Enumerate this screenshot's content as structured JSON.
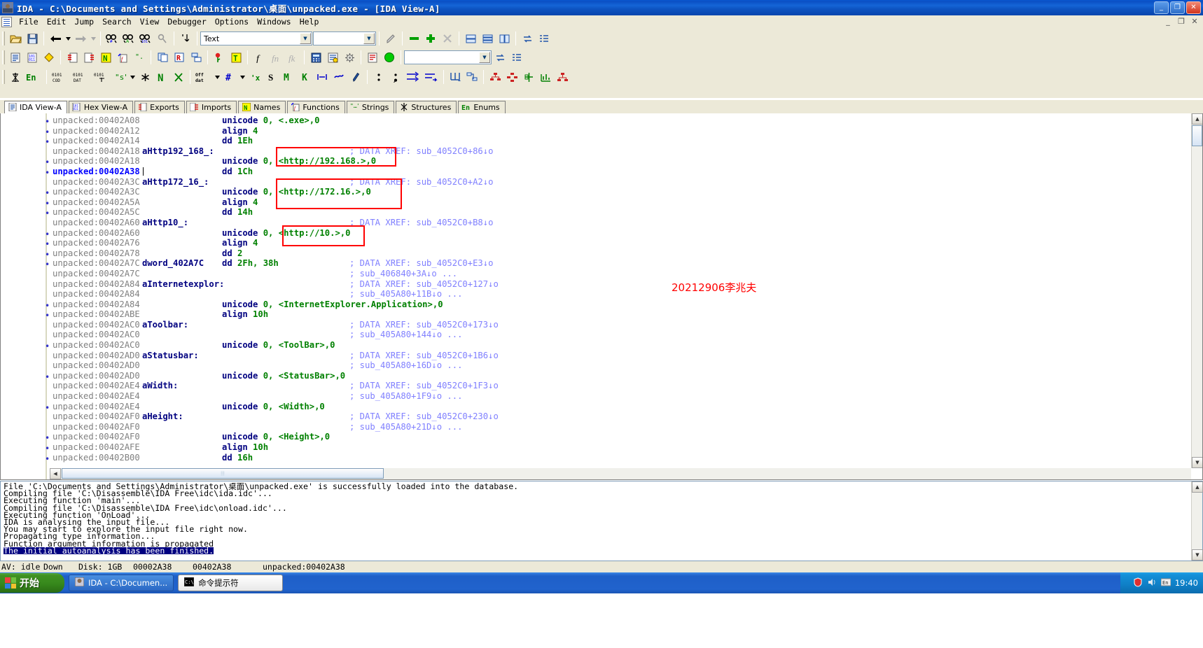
{
  "window": {
    "title": "IDA - C:\\Documents and Settings\\Administrator\\桌面\\unpacked.exe - [IDA View-A]",
    "minimize_label": "_",
    "maximize_label": "❐",
    "close_label": "✕",
    "mdi_minimize": "_",
    "mdi_restore": "❐",
    "mdi_close": "✕"
  },
  "menu": {
    "items": [
      {
        "label": "File"
      },
      {
        "label": "Edit"
      },
      {
        "label": "Jump"
      },
      {
        "label": "Search"
      },
      {
        "label": "View"
      },
      {
        "label": "Debugger"
      },
      {
        "label": "Options"
      },
      {
        "label": "Windows"
      },
      {
        "label": "Help"
      }
    ]
  },
  "toolbar": {
    "search_type_value": "Text",
    "search_term_value": "",
    "jump_combo_value": "",
    "func_combo_value": "",
    "accent_red": "#ff0000",
    "accent_green": "#008000",
    "accent_blue": "#0000ff"
  },
  "tabs": [
    {
      "label": "IDA View-A",
      "icon": "document-icon",
      "active": true
    },
    {
      "label": "Hex View-A",
      "icon": "hex-icon",
      "active": false
    },
    {
      "label": "Exports",
      "icon": "exports-icon",
      "active": false
    },
    {
      "label": "Imports",
      "icon": "imports-icon",
      "active": false
    },
    {
      "label": "Names",
      "icon": "names-icon",
      "active": false
    },
    {
      "label": "Functions",
      "icon": "functions-icon",
      "active": false
    },
    {
      "label": "Strings",
      "icon": "strings-icon",
      "active": false
    },
    {
      "label": "Structures",
      "icon": "structures-icon",
      "active": false
    },
    {
      "label": "Enums",
      "icon": "enums-icon",
      "active": false
    }
  ],
  "disassembly": {
    "annotation": "20212906李兆夫",
    "lines": [
      {
        "dot": true,
        "addr": "unpacked:00402A08",
        "label": "",
        "mnemonic": "unicode",
        "operand": "0, <.exe>,0",
        "xref": ""
      },
      {
        "dot": true,
        "addr": "unpacked:00402A12",
        "label": "",
        "mnemonic": "align",
        "operand": "4",
        "xref": ""
      },
      {
        "dot": true,
        "addr": "unpacked:00402A14",
        "label": "",
        "mnemonic": "dd",
        "operand": "1Eh",
        "xref": ""
      },
      {
        "dot": false,
        "addr": "unpacked:00402A18",
        "label": "aHttp192_168_:",
        "mnemonic": "",
        "operand": "",
        "xref": "; DATA XREF: sub_4052C0+86↓o"
      },
      {
        "dot": true,
        "addr": "unpacked:00402A18",
        "label": "",
        "mnemonic": "unicode",
        "operand": "0, <http://192.168.>,0",
        "xref": ""
      },
      {
        "dot": true,
        "addr": "unpacked:00402A38",
        "label": "",
        "mnemonic": "dd",
        "operand": "1Ch",
        "xref": "",
        "selected": true,
        "caret": true
      },
      {
        "dot": false,
        "addr": "unpacked:00402A3C",
        "label": "aHttp172_16_:",
        "mnemonic": "",
        "operand": "",
        "xref": "; DATA XREF: sub_4052C0+A2↓o"
      },
      {
        "dot": true,
        "addr": "unpacked:00402A3C",
        "label": "",
        "mnemonic": "unicode",
        "operand": "0, <http://172.16.>,0",
        "xref": ""
      },
      {
        "dot": true,
        "addr": "unpacked:00402A5A",
        "label": "",
        "mnemonic": "align",
        "operand": "4",
        "xref": ""
      },
      {
        "dot": true,
        "addr": "unpacked:00402A5C",
        "label": "",
        "mnemonic": "dd",
        "operand": "14h",
        "xref": ""
      },
      {
        "dot": false,
        "addr": "unpacked:00402A60",
        "label": "aHttp10_:",
        "mnemonic": "",
        "operand": "",
        "xref": "; DATA XREF: sub_4052C0+B8↓o"
      },
      {
        "dot": true,
        "addr": "unpacked:00402A60",
        "label": "",
        "mnemonic": "unicode",
        "operand": "0, <http://10.>,0",
        "xref": ""
      },
      {
        "dot": true,
        "addr": "unpacked:00402A76",
        "label": "",
        "mnemonic": "align",
        "operand": "4",
        "xref": ""
      },
      {
        "dot": true,
        "addr": "unpacked:00402A78",
        "label": "",
        "mnemonic": "dd",
        "operand": "2",
        "xref": ""
      },
      {
        "dot": true,
        "addr": "unpacked:00402A7C",
        "label": "dword_402A7C",
        "mnemonic": "dd",
        "operand": "2Fh, 38h",
        "xref": "; DATA XREF: sub_4052C0+E3↓o"
      },
      {
        "dot": false,
        "addr": "unpacked:00402A7C",
        "label": "",
        "mnemonic": "",
        "operand": "",
        "xref": "; sub_406840+3A↓o ..."
      },
      {
        "dot": false,
        "addr": "unpacked:00402A84",
        "label": "aInternetexplor:",
        "mnemonic": "",
        "operand": "",
        "xref": "; DATA XREF: sub_4052C0+127↓o"
      },
      {
        "dot": false,
        "addr": "unpacked:00402A84",
        "label": "",
        "mnemonic": "",
        "operand": "",
        "xref": "; sub_405A80+11B↓o ..."
      },
      {
        "dot": true,
        "addr": "unpacked:00402A84",
        "label": "",
        "mnemonic": "unicode",
        "operand": "0, <InternetExplorer.Application>,0",
        "xref": ""
      },
      {
        "dot": true,
        "addr": "unpacked:00402ABE",
        "label": "",
        "mnemonic": "align",
        "operand": "10h",
        "xref": ""
      },
      {
        "dot": false,
        "addr": "unpacked:00402AC0",
        "label": "aToolbar:",
        "mnemonic": "",
        "operand": "",
        "xref": "; DATA XREF: sub_4052C0+173↓o"
      },
      {
        "dot": false,
        "addr": "unpacked:00402AC0",
        "label": "",
        "mnemonic": "",
        "operand": "",
        "xref": "; sub_405A80+144↓o ..."
      },
      {
        "dot": true,
        "addr": "unpacked:00402AC0",
        "label": "",
        "mnemonic": "unicode",
        "operand": "0, <ToolBar>,0",
        "xref": ""
      },
      {
        "dot": false,
        "addr": "unpacked:00402AD0",
        "label": "aStatusbar:",
        "mnemonic": "",
        "operand": "",
        "xref": "; DATA XREF: sub_4052C0+1B6↓o"
      },
      {
        "dot": false,
        "addr": "unpacked:00402AD0",
        "label": "",
        "mnemonic": "",
        "operand": "",
        "xref": "; sub_405A80+16D↓o ..."
      },
      {
        "dot": true,
        "addr": "unpacked:00402AD0",
        "label": "",
        "mnemonic": "unicode",
        "operand": "0, <StatusBar>,0",
        "xref": ""
      },
      {
        "dot": false,
        "addr": "unpacked:00402AE4",
        "label": "aWidth:",
        "mnemonic": "",
        "operand": "",
        "xref": "; DATA XREF: sub_4052C0+1F3↓o"
      },
      {
        "dot": false,
        "addr": "unpacked:00402AE4",
        "label": "",
        "mnemonic": "",
        "operand": "",
        "xref": "; sub_405A80+1F9↓o ..."
      },
      {
        "dot": true,
        "addr": "unpacked:00402AE4",
        "label": "",
        "mnemonic": "unicode",
        "operand": "0, <Width>,0",
        "xref": ""
      },
      {
        "dot": false,
        "addr": "unpacked:00402AF0",
        "label": "aHeight:",
        "mnemonic": "",
        "operand": "",
        "xref": "; DATA XREF: sub_4052C0+230↓o"
      },
      {
        "dot": false,
        "addr": "unpacked:00402AF0",
        "label": "",
        "mnemonic": "",
        "operand": "",
        "xref": "; sub_405A80+21D↓o ..."
      },
      {
        "dot": true,
        "addr": "unpacked:00402AF0",
        "label": "",
        "mnemonic": "unicode",
        "operand": "0, <Height>,0",
        "xref": ""
      },
      {
        "dot": true,
        "addr": "unpacked:00402AFE",
        "label": "",
        "mnemonic": "align",
        "operand": "10h",
        "xref": ""
      },
      {
        "dot": true,
        "addr": "unpacked:00402B00",
        "label": "",
        "mnemonic": "dd",
        "operand": "16h",
        "xref": ""
      }
    ]
  },
  "output": {
    "lines": [
      "File 'C:\\Documents and Settings\\Administrator\\桌面\\unpacked.exe' is successfully loaded into the database.",
      "Compiling file 'C:\\Disassemble\\IDA Free\\idc\\ida.idc'...",
      "Executing function 'main'...",
      "Compiling file 'C:\\Disassemble\\IDA Free\\idc\\onload.idc'...",
      "Executing function 'OnLoad'...",
      "IDA is analysing the input file...",
      "You may start to explore the input file right now.",
      "Propagating type information...",
      "Function argument information is propagated"
    ],
    "highlighted_line": "The initial autoanalysis has been finished."
  },
  "statusbar": {
    "av": "AV: idle",
    "down": "Down",
    "disk": "Disk: 1GB",
    "offset": "00002A38",
    "address": "00402A38",
    "location": "unpacked:00402A38"
  },
  "taskbar": {
    "start_label": "开始",
    "items": [
      {
        "label": "IDA - C:\\Documen...",
        "icon": "ida-icon"
      },
      {
        "label": "命令提示符",
        "icon": "cmd-icon"
      }
    ],
    "clock": "19:40"
  }
}
